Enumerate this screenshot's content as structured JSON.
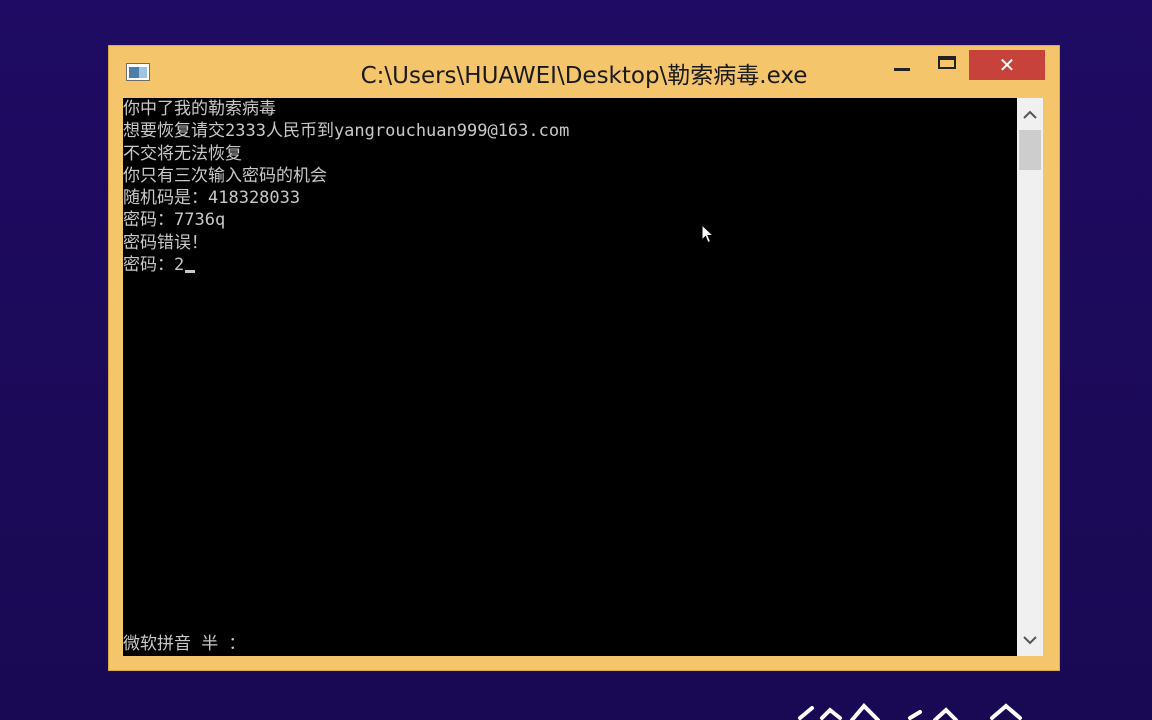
{
  "window": {
    "title": "C:\\Users\\HUAWEI\\Desktop\\勒索病毒.exe",
    "minimize_icon": "minimize-icon",
    "maximize_icon": "maximize-icon",
    "close_icon": "close-icon",
    "close_glyph": "✕"
  },
  "console": {
    "lines": [
      "你中了我的勒索病毒",
      "想要恢复请交2333人民币到yangrouchuan999@163.com",
      "不交将无法恢复",
      "你只有三次输入密码的机会",
      "随机码是：418328033",
      "密码：7736q",
      "密码错误！",
      "密码：2"
    ],
    "ime_status": "微软拼音 半 ："
  },
  "colors": {
    "desktop": "#1c0a5c",
    "window_frame": "#f4c56a",
    "close_button": "#c7423a",
    "console_bg": "#000000",
    "console_text": "#c8c8c8"
  }
}
